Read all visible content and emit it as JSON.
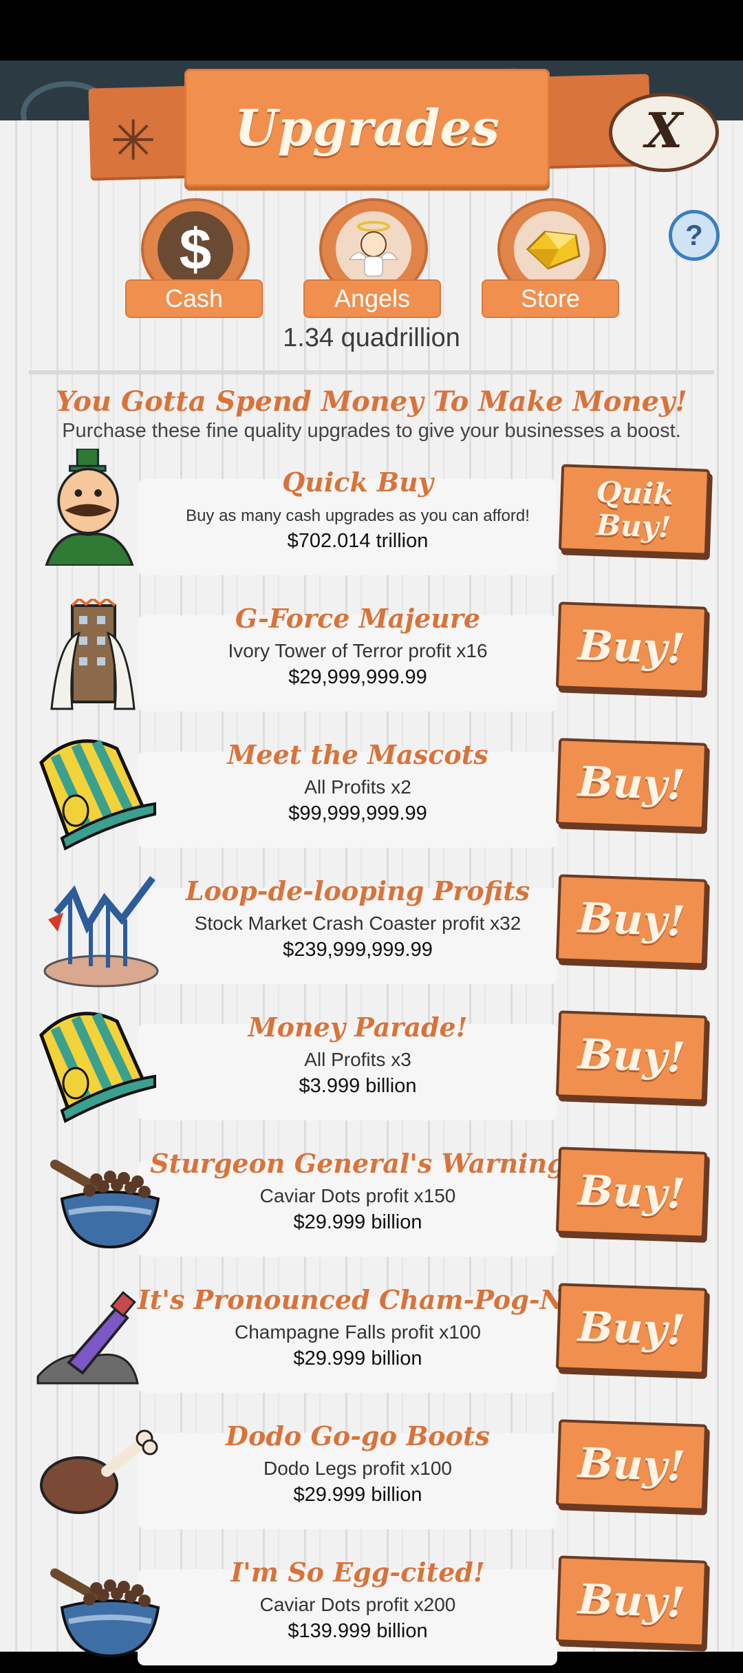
{
  "header": {
    "title": "Upgrades",
    "close_label": "X",
    "help_label": "?"
  },
  "tabs": [
    {
      "label": "Cash",
      "icon": "dollar-icon"
    },
    {
      "label": "Angels",
      "icon": "angel-icon"
    },
    {
      "label": "Store",
      "icon": "gold-icon"
    }
  ],
  "cash_amount": "1.34 quadrillion",
  "tagline": "You Gotta Spend Money To Make Money!",
  "subline": "Purchase these fine quality upgrades to give your businesses a boost.",
  "upgrades": [
    {
      "title": "Quick Buy",
      "desc": "Buy as many cash upgrades as you can afford!",
      "price": "$702.014 trillion",
      "button_line1": "Quik",
      "button_line2": "Buy!",
      "icon": "mascot-icon"
    },
    {
      "title": "G-Force Majeure",
      "desc": "Ivory Tower of Terror profit x16",
      "price": "$29,999,999.99",
      "button": "Buy!",
      "icon": "tower-icon"
    },
    {
      "title": "Meet the Mascots",
      "desc": "All Profits x2",
      "price": "$99,999,999.99",
      "button": "Buy!",
      "icon": "top-hat-icon"
    },
    {
      "title": "Loop-de-looping Profits",
      "desc": "Stock Market Crash Coaster profit x32",
      "price": "$239,999,999.99",
      "button": "Buy!",
      "icon": "coaster-icon"
    },
    {
      "title": "Money Parade!",
      "desc": "All Profits x3",
      "price": "$3.999 billion",
      "button": "Buy!",
      "icon": "top-hat-icon"
    },
    {
      "title": "Sturgeon General's Warning",
      "desc": "Caviar Dots profit x150",
      "price": "$29.999 billion",
      "button": "Buy!",
      "icon": "caviar-bowl-icon"
    },
    {
      "title": "It's Pronounced Cham-Pog-Na",
      "desc": "Champagne Falls profit x100",
      "price": "$29.999 billion",
      "button": "Buy!",
      "icon": "champagne-bottle-icon"
    },
    {
      "title": "Dodo Go-go Boots",
      "desc": "Dodo Legs profit x100",
      "price": "$29.999 billion",
      "button": "Buy!",
      "icon": "drumstick-icon"
    },
    {
      "title": "I'm So Egg-cited!",
      "desc": "Caviar Dots profit x200",
      "price": "$139.999 billion",
      "button": "Buy!",
      "icon": "caviar-bowl-icon"
    }
  ]
}
